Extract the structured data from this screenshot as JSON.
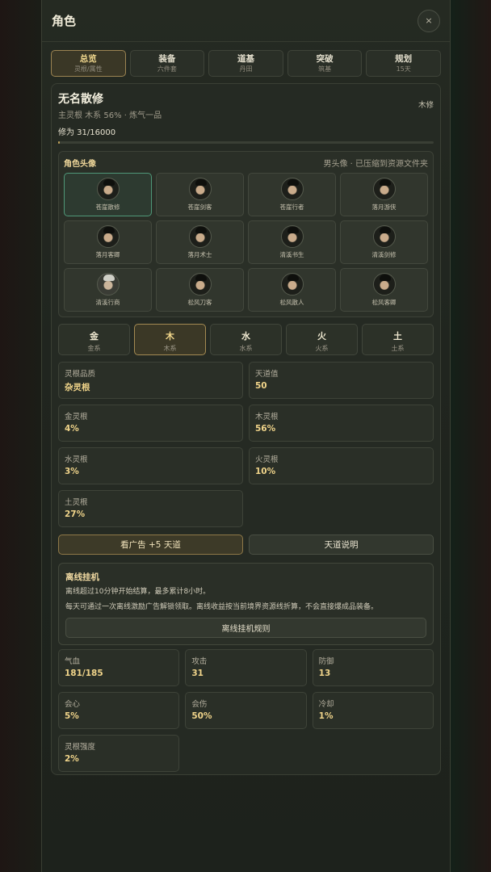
{
  "header": {
    "title": "角色",
    "close": "×"
  },
  "tabs": [
    {
      "label": "总览",
      "sub": "灵根/属性"
    },
    {
      "label": "装备",
      "sub": "六件套"
    },
    {
      "label": "道基",
      "sub": "丹田"
    },
    {
      "label": "突破",
      "sub": "筑基"
    },
    {
      "label": "规划",
      "sub": "15天"
    }
  ],
  "character": {
    "name": "无名散修",
    "sub": "主灵根 木系 56% · 炼气一品",
    "element_tag": "木修",
    "cultivation": "修为 31/16000",
    "progress": 0.0019
  },
  "avatar": {
    "title": "角色头像",
    "note": "男头像 · 已压缩到资源文件夹",
    "items": [
      "苍崖散修",
      "苍崖剑客",
      "苍崖行者",
      "落月游侠",
      "落月客卿",
      "落月术士",
      "清溪书生",
      "清溪剑修",
      "清溪行商",
      "松风刀客",
      "松风散人",
      "松风客卿"
    ]
  },
  "elements": [
    {
      "label": "金",
      "sub": "金系"
    },
    {
      "label": "木",
      "sub": "木系"
    },
    {
      "label": "水",
      "sub": "水系"
    },
    {
      "label": "火",
      "sub": "火系"
    },
    {
      "label": "土",
      "sub": "土系"
    }
  ],
  "roots": [
    {
      "k": "灵根品质",
      "v": "杂灵根"
    },
    {
      "k": "天道值",
      "v": "50"
    },
    {
      "k": "金灵根",
      "v": "4%"
    },
    {
      "k": "木灵根",
      "v": "56%"
    },
    {
      "k": "水灵根",
      "v": "3%"
    },
    {
      "k": "火灵根",
      "v": "10%"
    },
    {
      "k": "土灵根",
      "v": "27%"
    }
  ],
  "buttons": {
    "ad": "看广告 +5 天道",
    "info": "天道说明"
  },
  "offline": {
    "title": "离线挂机",
    "line1": "离线超过10分钟开始结算，最多累计8小时。",
    "line2": "每天可通过一次离线激励广告解锁领取。离线收益按当前境界资源线折算，不会直接爆成品装备。",
    "rules": "离线挂机规则"
  },
  "stats": [
    {
      "k": "气血",
      "v": "181/185"
    },
    {
      "k": "攻击",
      "v": "31"
    },
    {
      "k": "防御",
      "v": "13"
    },
    {
      "k": "会心",
      "v": "5%"
    },
    {
      "k": "会伤",
      "v": "50%"
    },
    {
      "k": "冷却",
      "v": "1%"
    },
    {
      "k": "灵根强度",
      "v": "2%"
    }
  ],
  "colors": {
    "accent_gold": "#f0d48a",
    "active_border": "#9c8452",
    "selected_avatar": "#4f9878"
  }
}
